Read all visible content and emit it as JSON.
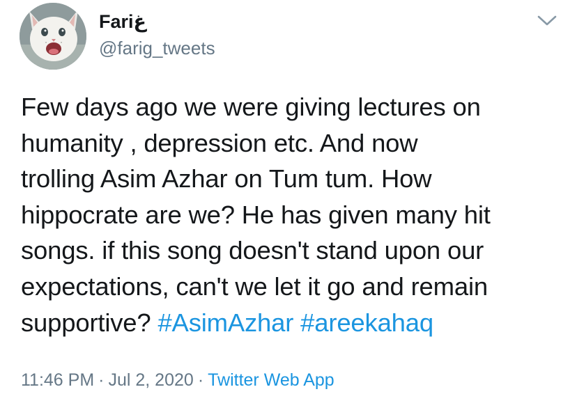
{
  "author": {
    "display_name": "Fariغ",
    "handle": "@farig_tweets",
    "avatar_icon": "cat-avatar-icon"
  },
  "menu": {
    "icon": "chevron-down-icon"
  },
  "tweet": {
    "lines": [
      "Few days ago we were giving lectures on",
      "humanity , depression etc. And now",
      "trolling Asim Azhar on Tum tum. How",
      "hippocrate are we? He has given many hit",
      "songs. if this song doesn't stand upon our",
      "expectations, can't we let it go and remain"
    ],
    "last_line_text": "supportive? ",
    "hashtags": [
      "#AsimAzhar",
      "#areekahaq"
    ]
  },
  "meta": {
    "time": "11:46 PM",
    "date": "Jul 2, 2020",
    "separator": "·",
    "source": "Twitter Web App"
  },
  "colors": {
    "text": "#14171a",
    "secondary": "#657786",
    "link": "#1b95e0"
  }
}
